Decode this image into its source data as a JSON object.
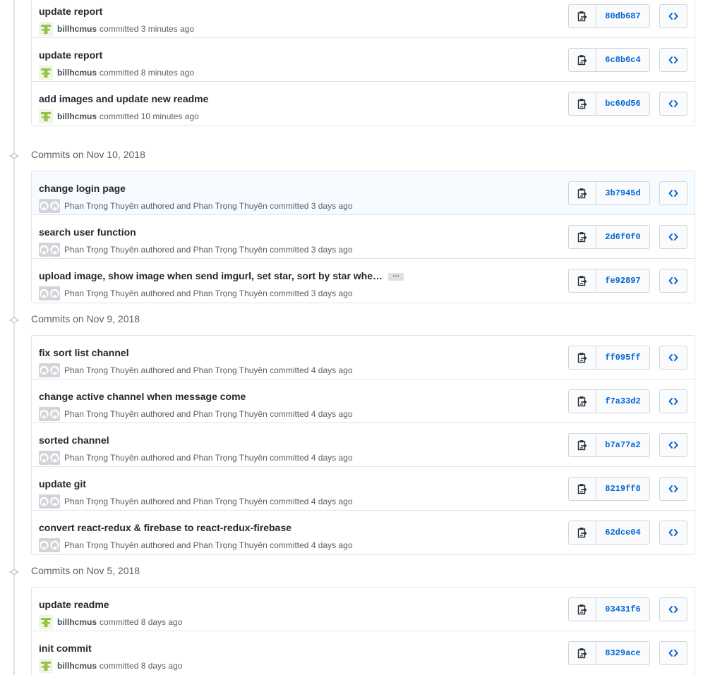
{
  "colors": {
    "link": "#0366d6",
    "muted": "#586069",
    "border": "#e1e4e8",
    "highlight": "#f6fbff"
  },
  "icons": {
    "copy": "clippy-icon",
    "browse": "code-icon",
    "timeline": "git-commit-icon"
  },
  "groups": [
    {
      "label": "",
      "commits": [
        {
          "title": "update report",
          "author": "billhcmus",
          "author_style": "strong",
          "avatar": "identicon-green",
          "text": "committed 3 minutes ago",
          "sha": "80db687"
        },
        {
          "title": "update report",
          "author": "billhcmus",
          "author_style": "strong",
          "avatar": "identicon-green",
          "text": "committed 8 minutes ago",
          "sha": "6c8b6c4"
        },
        {
          "title": "add images and update new readme",
          "author": "billhcmus",
          "author_style": "strong",
          "avatar": "identicon-green",
          "text": "committed 10 minutes ago",
          "sha": "bc60d56"
        }
      ]
    },
    {
      "label": "Commits on Nov 10, 2018",
      "commits": [
        {
          "title": "change login page",
          "author": "",
          "author_style": "plain",
          "avatar": "octocat-pair",
          "text": "Phan Trọng Thuyên authored and Phan Trọng Thuyên committed 3 days ago",
          "sha": "3b7945d",
          "highlighted": true
        },
        {
          "title": "search user function",
          "author": "",
          "author_style": "plain",
          "avatar": "octocat-pair",
          "text": "Phan Trọng Thuyên authored and Phan Trọng Thuyên committed 3 days ago",
          "sha": "2d6f0f0"
        },
        {
          "title": "upload image, show image when send imgurl, set star, sort by star whe…",
          "author": "",
          "author_style": "plain",
          "avatar": "octocat-pair",
          "text": "Phan Trọng Thuyên authored and Phan Trọng Thuyên committed 3 days ago",
          "sha": "fe92897",
          "has_more": true,
          "more_label": "…"
        }
      ]
    },
    {
      "label": "Commits on Nov 9, 2018",
      "commits": [
        {
          "title": "fix sort list channel",
          "author": "",
          "author_style": "plain",
          "avatar": "octocat-pair",
          "text": "Phan Trọng Thuyên authored and Phan Trọng Thuyên committed 4 days ago",
          "sha": "ff095ff"
        },
        {
          "title": "change active channel when message come",
          "author": "",
          "author_style": "plain",
          "avatar": "octocat-pair",
          "text": "Phan Trọng Thuyên authored and Phan Trọng Thuyên committed 4 days ago",
          "sha": "f7a33d2"
        },
        {
          "title": "sorted channel",
          "author": "",
          "author_style": "plain",
          "avatar": "octocat-pair",
          "text": "Phan Trọng Thuyên authored and Phan Trọng Thuyên committed 4 days ago",
          "sha": "b7a77a2"
        },
        {
          "title": "update git",
          "author": "",
          "author_style": "plain",
          "avatar": "octocat-pair",
          "text": "Phan Trọng Thuyên authored and Phan Trọng Thuyên committed 4 days ago",
          "sha": "8219ff8"
        },
        {
          "title": "convert react-redux & firebase to react-redux-firebase",
          "author": "",
          "author_style": "plain",
          "avatar": "octocat-pair",
          "text": "Phan Trọng Thuyên authored and Phan Trọng Thuyên committed 4 days ago",
          "sha": "62dce04"
        }
      ]
    },
    {
      "label": "Commits on Nov 5, 2018",
      "commits": [
        {
          "title": "update readme",
          "author": "billhcmus",
          "author_style": "strong",
          "avatar": "identicon-green",
          "text": "committed 8 days ago",
          "sha": "03431f6"
        },
        {
          "title": "init commit",
          "author": "billhcmus",
          "author_style": "strong",
          "avatar": "identicon-green",
          "text": "committed 8 days ago",
          "sha": "8329ace"
        }
      ]
    }
  ]
}
